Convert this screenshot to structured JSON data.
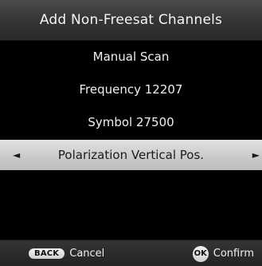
{
  "title": "Add Non-Freesat Channels",
  "menu": {
    "items": [
      {
        "label": "Manual Scan"
      },
      {
        "label": "Frequency 12207"
      },
      {
        "label": "Symbol 27500"
      },
      {
        "label": "Polarization Vertical Pos.",
        "selected": true
      }
    ],
    "arrow_left": "◄",
    "arrow_right": "►"
  },
  "footer": {
    "back_key": "BACK",
    "back_label": "Cancel",
    "ok_key": "OK",
    "ok_label": "Confirm"
  },
  "colors": {
    "background": "#000000",
    "highlight": "#d0d0d0",
    "text": "#f0f0f0"
  }
}
